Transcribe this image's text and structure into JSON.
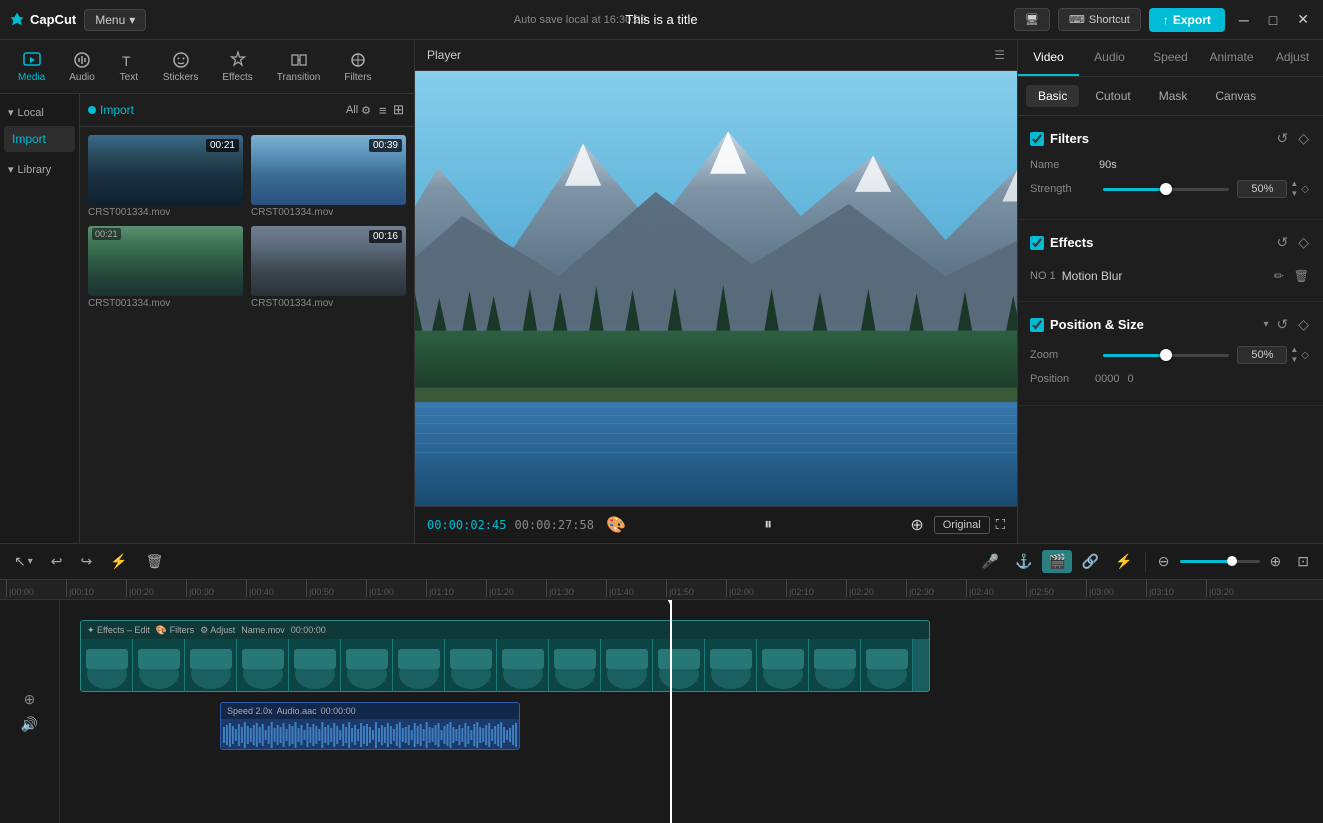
{
  "app": {
    "name": "CapCut",
    "menu_label": "Menu",
    "autosave": "Auto save local at 16:30:29",
    "title": "This is a title"
  },
  "topbar": {
    "shortcut_label": "Shortcut",
    "export_label": "Export"
  },
  "toolbar": {
    "items": [
      {
        "id": "media",
        "label": "Media"
      },
      {
        "id": "audio",
        "label": "Audio"
      },
      {
        "id": "text",
        "label": "Text"
      },
      {
        "id": "stickers",
        "label": "Stickers"
      },
      {
        "id": "effects",
        "label": "Effects"
      },
      {
        "id": "transition",
        "label": "Transition"
      },
      {
        "id": "filters",
        "label": "Filters"
      }
    ],
    "active": "media"
  },
  "sidebar": {
    "local_label": "Local",
    "library_label": "Library",
    "import_label": "Import"
  },
  "media_grid": {
    "all_label": "All",
    "items": [
      {
        "duration": "00:21",
        "filename": "CRST001334.mov"
      },
      {
        "duration": "00:39",
        "filename": "CRST001334.mov"
      },
      {
        "duration": "",
        "filename": "CRST001334.mov"
      },
      {
        "duration": "00:16",
        "filename": "CRST001334.mov"
      }
    ]
  },
  "player": {
    "title": "Player",
    "time_current": "00:00:02:45",
    "time_total": "00:00:27:58",
    "original_label": "Original"
  },
  "right_panel": {
    "tabs": [
      "Video",
      "Audio",
      "Speed",
      "Animate",
      "Adjust"
    ],
    "active_tab": "Video",
    "sub_tabs": [
      "Basic",
      "Cutout",
      "Mask",
      "Canvas"
    ],
    "active_sub_tab": "Basic",
    "filters_section": {
      "title": "Filters",
      "name_label": "Name",
      "name_value": "90s",
      "strength_label": "Strength",
      "strength_value": "50%"
    },
    "effects_section": {
      "title": "Effects",
      "effect_num": "NO 1",
      "effect_name": "Motion Blur"
    },
    "position_section": {
      "title": "Position & Size",
      "zoom_label": "Zoom",
      "zoom_value": "50%",
      "position_label": "Position"
    }
  },
  "timeline": {
    "undo_label": "↩",
    "redo_label": "↪",
    "split_label": "⚡",
    "delete_label": "🗑",
    "playhead_position": "02:45",
    "ruler_marks": [
      "00:00",
      "00:10",
      "00:20",
      "00:30",
      "00:40",
      "00:50",
      "01:00",
      "01:10",
      "01:20",
      "01:30",
      "01:40",
      "01:50",
      "02:00",
      "02:10",
      "02:20",
      "02:30",
      "02:40",
      "02:50",
      "03:00",
      "03:10",
      "03:20"
    ],
    "video_clip": {
      "tags": [
        "Effects – Edit",
        "Filters",
        "Adjust"
      ],
      "filename": "Name.mov",
      "timecode": "00:00:00"
    },
    "audio_clip": {
      "speed": "Speed 2.0x",
      "name": "Audio.aac",
      "timecode": "00:00:00"
    }
  }
}
